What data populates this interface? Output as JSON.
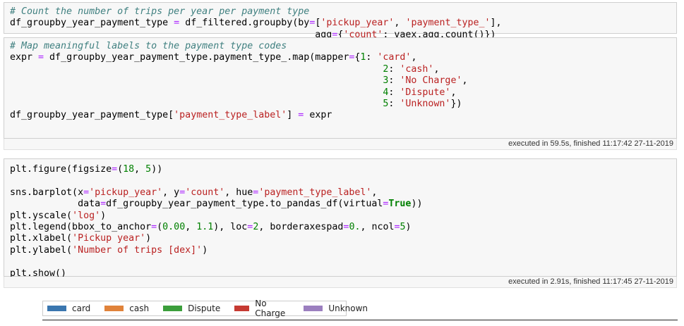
{
  "cell1": {
    "comment": "# Count the number of trips per year per payment type",
    "l2_a": "df_groupby_year_payment_type ",
    "l2_eq": "=",
    "l2_b": " df_filtered.groupby(by",
    "l2_eq2": "=",
    "l2_c": "[",
    "l2_s1": "'pickup_year'",
    "l2_d": ", ",
    "l2_s2": "'payment_type_'",
    "l2_e": "],",
    "l3_indent": "                                                      ",
    "l3_a": "agg",
    "l3_eq": "=",
    "l3_b": "{",
    "l3_s1": "'count'",
    "l3_c": ": vaex.agg.count()})"
  },
  "cell2": {
    "comment": "# Map meaningful labels to the payment type codes",
    "l2_a": "expr ",
    "l2_eq": "=",
    "l2_b": " df_groupby_year_payment_type.payment_type_.map(mapper",
    "l2_eq2": "=",
    "l2_c": "{",
    "l2_n": "1",
    "l2_d": ": ",
    "l2_s": "'card'",
    "l2_e": ",",
    "indent": "                                                                  ",
    "l3_n": "2",
    "l3_s": "'cash'",
    "l4_n": "3",
    "l4_s": "'No Charge'",
    "l5_n": "4",
    "l5_s": "'Dispute'",
    "l6_n": "5",
    "l6_s": "'Unknown'",
    "l6_e": "})",
    "l7_a": "df_groupby_year_payment_type[",
    "l7_s": "'payment_type_label'",
    "l7_b": "] ",
    "l7_eq": "=",
    "l7_c": " expr",
    "colon": ": ",
    "comma": ","
  },
  "status1": "executed in 59.5s, finished 11:17:42 27-11-2019",
  "cell3": {
    "l1_a": "plt.figure(figsize",
    "l1_eq": "=",
    "l1_b": "(",
    "l1_n1": "18",
    "l1_c": ", ",
    "l1_n2": "5",
    "l1_d": "))",
    "l3_a": "sns.barplot(x",
    "l3_eq1": "=",
    "l3_s1": "'pickup_year'",
    "l3_b": ", y",
    "l3_eq2": "=",
    "l3_s2": "'count'",
    "l3_c": ", hue",
    "l3_eq3": "=",
    "l3_s3": "'payment_type_label'",
    "l3_d": ",",
    "l4_indent": "            ",
    "l4_a": "data",
    "l4_eq1": "=",
    "l4_b": "df_groupby_year_payment_type.to_pandas_df(virtual",
    "l4_eq2": "=",
    "l4_kw": "True",
    "l4_c": "))",
    "l5_a": "plt.yscale(",
    "l5_s": "'log'",
    "l5_b": ")",
    "l6_a": "plt.legend(bbox_to_anchor",
    "l6_eq1": "=",
    "l6_b": "(",
    "l6_n1": "0.00",
    "l6_c": ", ",
    "l6_n2": "1.1",
    "l6_d": "), loc",
    "l6_eq2": "=",
    "l6_n3": "2",
    "l6_e": ", borderaxespad",
    "l6_eq3": "=",
    "l6_n4": "0.",
    "l6_f": ", ncol",
    "l6_eq4": "=",
    "l6_n5": "5",
    "l6_g": ")",
    "l7_a": "plt.xlabel(",
    "l7_s": "'Pickup year'",
    "l7_b": ")",
    "l8_a": "plt.ylabel(",
    "l8_s": "'Number of trips [dex]'",
    "l8_b": ")",
    "l10": "plt.show()"
  },
  "status2": "executed in 2.91s, finished 11:17:45 27-11-2019",
  "legend": {
    "items": [
      {
        "label": "card",
        "color": "#3a76af"
      },
      {
        "label": "cash",
        "color": "#e0823a"
      },
      {
        "label": "Dispute",
        "color": "#3b9e3b"
      },
      {
        "label": "No Charge",
        "color": "#c63a32"
      },
      {
        "label": "Unknown",
        "color": "#9b7fbf"
      }
    ]
  }
}
